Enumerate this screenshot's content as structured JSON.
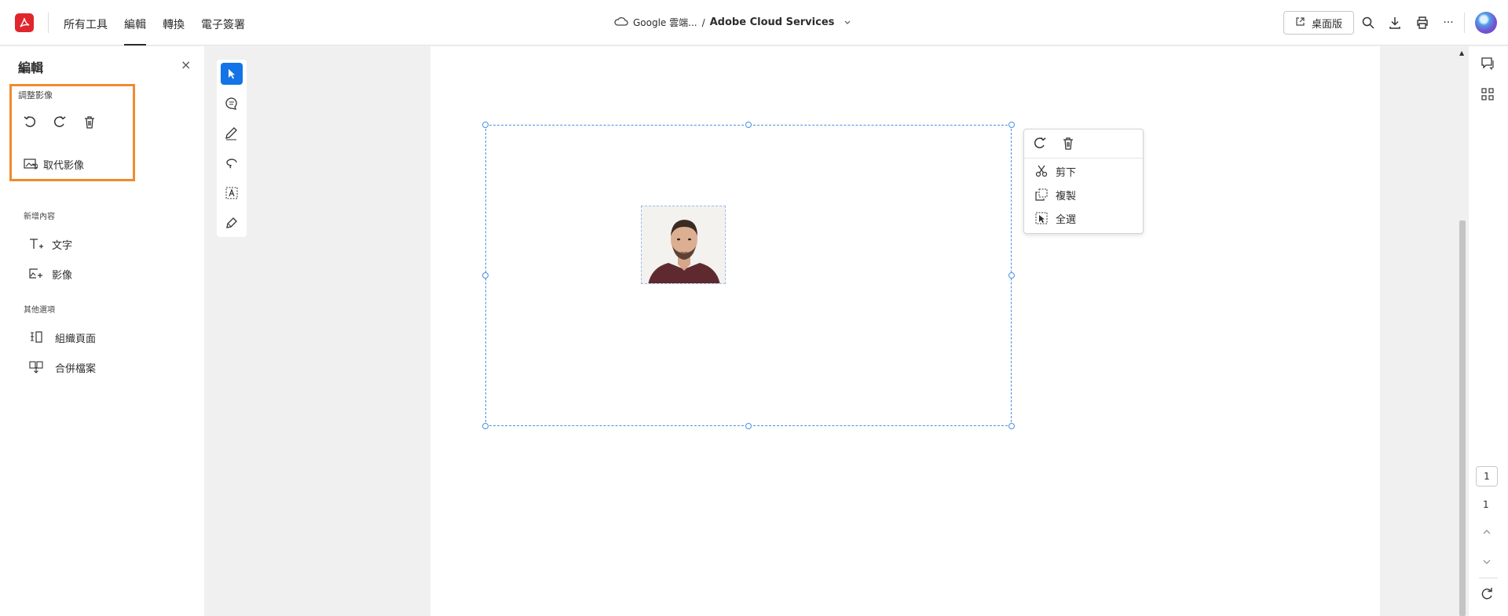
{
  "topbar": {
    "menu": [
      "所有工具",
      "編輯",
      "轉換",
      "電子簽署"
    ],
    "active_menu": "編輯",
    "breadcrumb_folder": "Google 雲端...",
    "breadcrumb_sep": "/",
    "breadcrumb_title": "Adobe Cloud Services",
    "desktop_button": "桌面版",
    "more": "···"
  },
  "panel": {
    "title": "編輯",
    "close": "×",
    "adjust_label": "調整影像",
    "replace_image": "取代影像",
    "add_content_label": "新增內容",
    "add_text": "文字",
    "add_image": "影像",
    "other_label": "其他選項",
    "organize_pages": "組織頁面",
    "combine_files": "合併檔案"
  },
  "context_menu": {
    "cut": "剪下",
    "copy": "複製",
    "select_all": "全選"
  },
  "pagination": {
    "current": "1",
    "total": "1"
  },
  "icons": [
    "acrobat-logo-icon",
    "cloud-icon",
    "chevron-down-icon",
    "open-external-icon",
    "search-icon",
    "download-icon",
    "print-icon",
    "more-icon",
    "rotate-left-icon",
    "rotate-right-icon",
    "trash-icon",
    "replace-image-icon",
    "add-text-icon",
    "add-image-icon",
    "organize-pages-icon",
    "combine-files-icon",
    "select-cursor-icon",
    "comment-icon",
    "pen-icon",
    "lasso-icon",
    "text-select-icon",
    "sign-icon",
    "cut-icon",
    "copy-icon",
    "select-all-icon",
    "comments-panel-icon",
    "thumbnails-icon",
    "refresh-icon"
  ],
  "colors": {
    "accent": "#1473e6",
    "highlight": "#f08a2c",
    "acrobat_red": "#e0252c"
  }
}
